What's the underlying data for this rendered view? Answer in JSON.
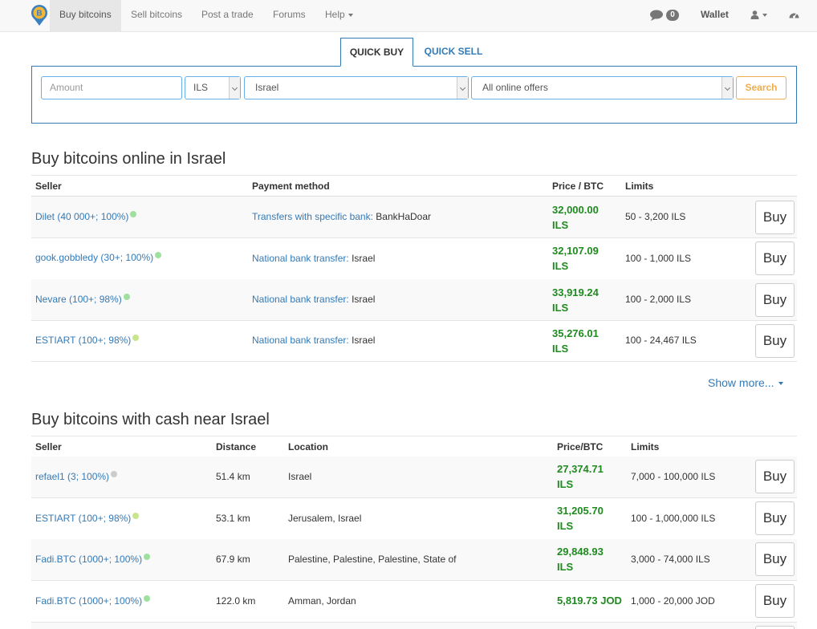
{
  "nav": {
    "items": [
      "Buy bitcoins",
      "Sell bitcoins",
      "Post a trade",
      "Forums",
      "Help"
    ],
    "message_count": "0",
    "wallet_label": "Wallet"
  },
  "quick": {
    "tab_buy": "QUICK BUY",
    "tab_sell": "QUICK SELL",
    "amount_placeholder": "Amount",
    "currency": "ILS",
    "country": "Israel",
    "offer_type": "All online offers",
    "search_label": "Search"
  },
  "online": {
    "title": "Buy bitcoins online in Israel",
    "headers": [
      "Seller",
      "Payment method",
      "Price / BTC",
      "Limits"
    ],
    "rows": [
      {
        "seller": "Dilet (40 000+; 100%)",
        "method": "Transfers with specific bank:",
        "method_detail": "BankHaDoar",
        "price": "32,000.00",
        "price_unit": "ILS",
        "limits": "50 - 3,200 ILS",
        "buy": "Buy"
      },
      {
        "seller": "gook.gobbledy (30+; 100%)",
        "method": "National bank transfer:",
        "method_detail": "Israel",
        "price": "32,107.09",
        "price_unit": "ILS",
        "limits": "100 - 1,000 ILS",
        "buy": "Buy"
      },
      {
        "seller": "Nevare (100+; 98%)",
        "method": "National bank transfer:",
        "method_detail": "Israel",
        "price": "33,919.24",
        "price_unit": "ILS",
        "limits": "100 - 2,000 ILS",
        "buy": "Buy"
      },
      {
        "seller": "ESTIART (100+; 98%)",
        "method": "National bank transfer:",
        "method_detail": "Israel",
        "price": "35,276.01",
        "price_unit": "ILS",
        "limits": "100 - 24,467 ILS",
        "buy": "Buy"
      }
    ],
    "show_more": "Show more..."
  },
  "cash": {
    "title": "Buy bitcoins with cash near Israel",
    "headers": [
      "Seller",
      "Distance",
      "Location",
      "Price/BTC",
      "Limits"
    ],
    "rows": [
      {
        "seller": "refael1 (3; 100%)",
        "distance": "51.4 km",
        "location": "Israel",
        "price": "27,374.71",
        "price_unit": "ILS",
        "limits": "7,000 - 100,000 ILS",
        "buy": "Buy"
      },
      {
        "seller": "ESTIART (100+; 98%)",
        "distance": "53.1 km",
        "location": "Jerusalem, Israel",
        "price": "31,205.70",
        "price_unit": "ILS",
        "limits": "100 - 1,000,000 ILS",
        "buy": "Buy"
      },
      {
        "seller": "Fadi.BTC (1000+; 100%)",
        "distance": "67.9 km",
        "location": "Palestine, Palestine, Palestine, State of",
        "price": "29,848.93",
        "price_unit": "ILS",
        "limits": "3,000 - 74,000 ILS",
        "buy": "Buy"
      },
      {
        "seller": "Fadi.BTC (1000+; 100%)",
        "distance": "122.0 km",
        "location": "Amman, Jordan",
        "price": "5,819.73 JOD",
        "price_unit": "",
        "limits": "1,000 - 20,000 JOD",
        "buy": "Buy"
      }
    ]
  },
  "colors": {
    "link": "#337ab7",
    "price": "#1f8a1f",
    "search": "#f0ad4e",
    "online_dot": "#9fe09f"
  }
}
